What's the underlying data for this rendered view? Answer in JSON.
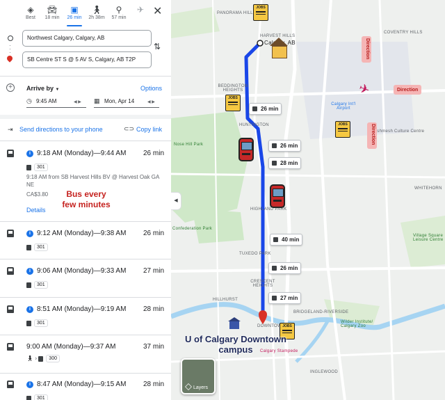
{
  "travel_modes": [
    {
      "name": "Best",
      "icon": "route-diamond-icon",
      "label": "Best"
    },
    {
      "name": "Driving",
      "icon": "car-icon",
      "label": "18 min"
    },
    {
      "name": "Transit",
      "icon": "transit-icon",
      "label": "26 min",
      "selected": true
    },
    {
      "name": "Walking",
      "icon": "walk-icon",
      "label": "2h 38m"
    },
    {
      "name": "Cycling",
      "icon": "bike-icon",
      "label": "57 min"
    },
    {
      "name": "Flight",
      "icon": "airplane-icon",
      "label": ""
    }
  ],
  "origin": "Northwest Calgary, Calgary, AB",
  "destination": "SB Centre ST S @ 5 AV S, Calgary, AB T2P",
  "arrive_by": "Arrive by",
  "options": "Options",
  "time": "9:45 AM",
  "date": "Mon, Apr 14",
  "send_directions": "Send directions to your phone",
  "copy_link": "Copy link",
  "routes": [
    {
      "time": "9:18 AM (Monday)—9:44 AM",
      "duration": "26 min",
      "legs": [
        {
          "mode": "bus",
          "line": "301"
        }
      ],
      "detail": "9:18 AM from SB Harvest Hills BV @ Harvest Oak GA NE",
      "fare": "CA$3.80",
      "details_link": "Details"
    },
    {
      "time": "9:12 AM (Monday)—9:38 AM",
      "duration": "26 min",
      "legs": [
        {
          "mode": "bus",
          "line": "301"
        }
      ]
    },
    {
      "time": "9:06 AM (Monday)—9:33 AM",
      "duration": "27 min",
      "legs": [
        {
          "mode": "bus",
          "line": "301"
        }
      ]
    },
    {
      "time": "8:51 AM (Monday)—9:19 AM",
      "duration": "28 min",
      "legs": [
        {
          "mode": "bus",
          "line": "301"
        }
      ]
    },
    {
      "time": "9:00 AM (Monday)—9:37 AM",
      "duration": "37 min",
      "legs": [
        {
          "mode": "walk"
        },
        {
          "mode": "bus",
          "line": "300"
        }
      ]
    },
    {
      "time": "8:47 AM (Monday)—9:15 AM",
      "duration": "28 min",
      "legs": [
        {
          "mode": "bus",
          "line": "301"
        }
      ]
    }
  ],
  "annotation": "Bus every few minutes",
  "map": {
    "labels": [
      "PANORAMA HILLS",
      "COVENTRY HILLS",
      "HARVEST HILLS",
      "Calgary, AB",
      "BEDDINGTON HEIGHTS",
      "Calgary Int'l Airport",
      "Dashmesh Culture Centre",
      "HUNTINGTON",
      "Nose Hill Park",
      "HIGHLAND PARK",
      "Confederation Park",
      "TUXEDO PARK",
      "CRESCENT HEIGHTS",
      "HILLHURST",
      "BRIDGELAND-RIVERSIDE",
      "DOWNTOWN",
      "Wilder Institute/ Calgary Zoo",
      "Calgary Stampede",
      "INGLEWOOD",
      "Village Square Leisure Centre",
      "WHITEHORN"
    ],
    "chips": [
      "26 min",
      "26 min",
      "28 min",
      "40 min",
      "26 min",
      "27 min"
    ],
    "direction_labels": [
      "Direction",
      "Direction",
      "Direction"
    ],
    "jobs_label": "JOBS",
    "campus_label": "U of Calgary Downtown campus",
    "layers": "Layers",
    "route_color": "#1a47e8",
    "park_color": "#cfe8c8",
    "water_color": "#a6d4f2"
  }
}
